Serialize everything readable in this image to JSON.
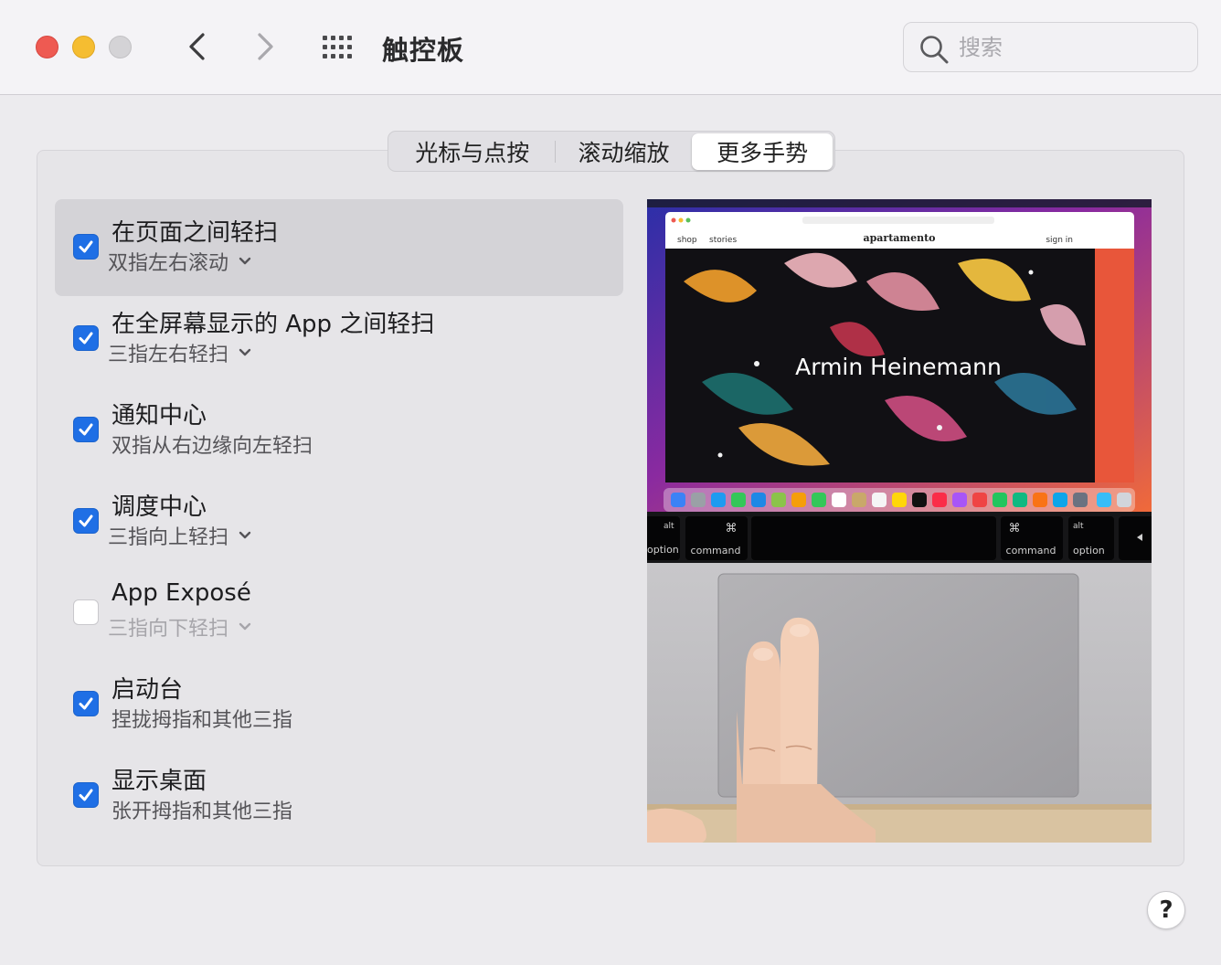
{
  "window": {
    "title": "触控板",
    "search_placeholder": "搜索"
  },
  "tabs": [
    {
      "label": "光标与点按"
    },
    {
      "label": "滚动缩放"
    },
    {
      "label": "更多手势",
      "selected": true
    }
  ],
  "gestures": [
    {
      "title": "在页面之间轻扫",
      "subtitle": "双指左右滚动",
      "checked": true,
      "has_dropdown": true,
      "selected": true
    },
    {
      "title": "在全屏幕显示的 App 之间轻扫",
      "subtitle": "三指左右轻扫",
      "checked": true,
      "has_dropdown": true
    },
    {
      "title": "通知中心",
      "subtitle": "双指从右边缘向左轻扫",
      "checked": true,
      "has_dropdown": false
    },
    {
      "title": "调度中心",
      "subtitle": "三指向上轻扫",
      "checked": true,
      "has_dropdown": true
    },
    {
      "title": "App Exposé",
      "subtitle": "三指向下轻扫",
      "checked": false,
      "has_dropdown": true
    },
    {
      "title": "启动台",
      "subtitle": "捏拢拇指和其他三指",
      "checked": true,
      "has_dropdown": false
    },
    {
      "title": "显示桌面",
      "subtitle": "张开拇指和其他三指",
      "checked": true,
      "has_dropdown": false
    }
  ],
  "preview": {
    "browser_tab_1": "shop",
    "browser_tab_2": "stories",
    "site_name": "apartamento",
    "sign_in": "sign in",
    "hero_text": "Armin Heinemann",
    "key_alt": "alt",
    "key_option": "option",
    "key_cmd_symbol": "⌘",
    "key_command": "command"
  },
  "help_label": "?",
  "colors": {
    "accent": "#1f6fe5",
    "window_bg": "#ecebee",
    "selected_row": "#d4d3d7"
  }
}
